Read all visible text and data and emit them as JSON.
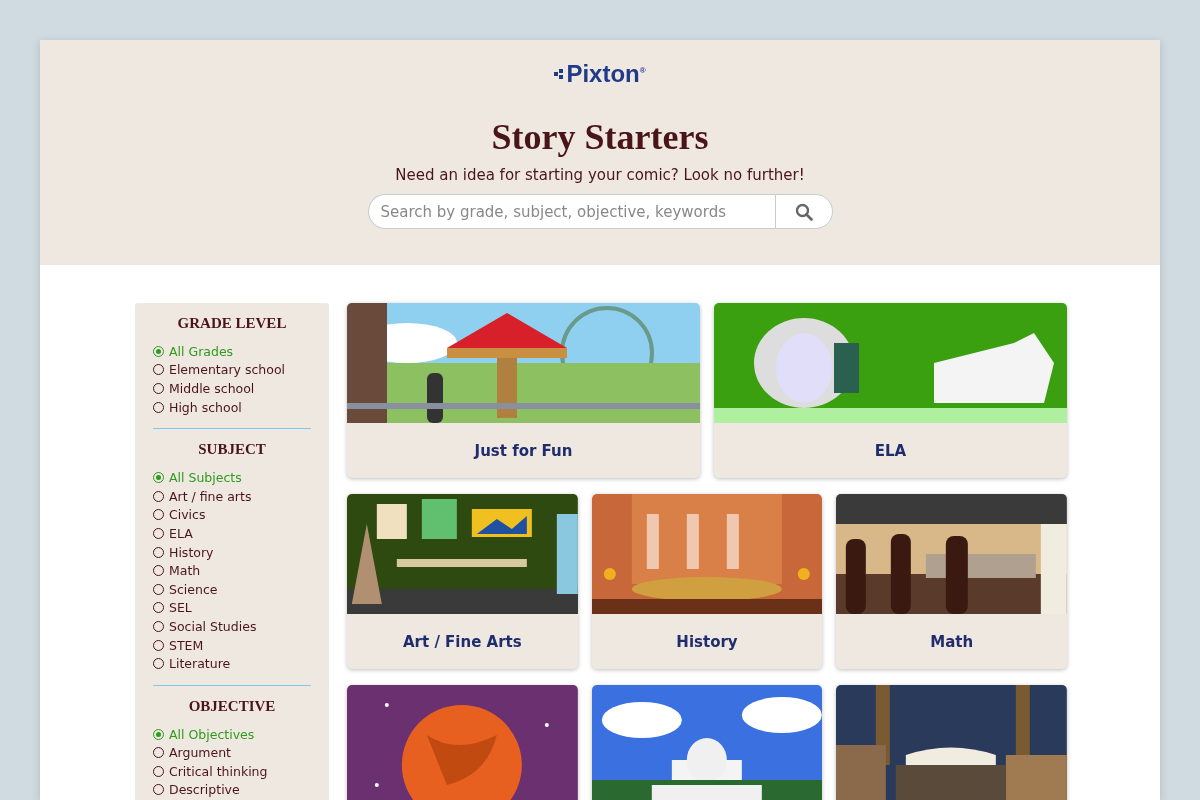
{
  "header": {
    "logo": "Pixton$^{®}$",
    "title": "Story Starters",
    "subtitle": "Need an idea for starting your comic? Look no further!",
    "search": {
      "placeholder": "Search by grade, subject, objective, keywords"
    }
  },
  "filters": [
    {
      "heading": "GRADE LEVEL",
      "options": [
        {
          "label": "All Grades",
          "selected": true
        },
        {
          "label": "Elementary school",
          "selected": false
        },
        {
          "label": "Middle school",
          "selected": false
        },
        {
          "label": "High school",
          "selected": false
        }
      ]
    },
    {
      "heading": "SUBJECT",
      "options": [
        {
          "label": "All Subjects",
          "selected": true
        },
        {
          "label": "Art / fine arts",
          "selected": false
        },
        {
          "label": "Civics",
          "selected": false
        },
        {
          "label": "ELA",
          "selected": false
        },
        {
          "label": "History",
          "selected": false
        },
        {
          "label": "Math",
          "selected": false
        },
        {
          "label": "Science",
          "selected": false
        },
        {
          "label": "SEL",
          "selected": false
        },
        {
          "label": "Social Studies",
          "selected": false
        },
        {
          "label": "STEM",
          "selected": false
        },
        {
          "label": "Literature",
          "selected": false
        }
      ]
    },
    {
      "heading": "OBJECTIVE",
      "options": [
        {
          "label": "All Objectives",
          "selected": true
        },
        {
          "label": "Argument",
          "selected": false
        },
        {
          "label": "Critical thinking",
          "selected": false
        },
        {
          "label": "Descriptive",
          "selected": false
        }
      ]
    }
  ],
  "card_rows": [
    [
      {
        "kind": "titled",
        "title": "Just for Fun"
      },
      {
        "kind": "titled",
        "title": "ELA"
      }
    ],
    [
      {
        "kind": "titled",
        "title": "Art / Fine Arts"
      },
      {
        "kind": "titled",
        "title": "History"
      },
      {
        "kind": "titled",
        "title": "Math"
      }
    ],
    [
      {
        "kind": "picture"
      },
      {
        "kind": "picture"
      },
      {
        "kind": "picture"
      }
    ]
  ]
}
